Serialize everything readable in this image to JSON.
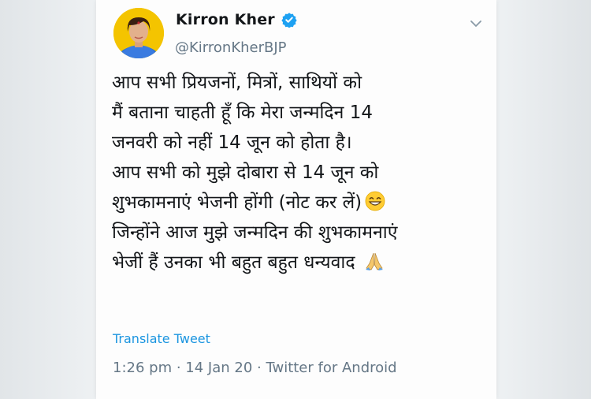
{
  "tweet": {
    "author_name": "Kirron Kher",
    "author_handle": "@KirronKherBJP",
    "lines": [
      "आप सभी प्रियजनों, मित्रों, साथियों को",
      "मैं बताना चाहती हूँ कि मेरा जन्मदिन 14",
      "जनवरी को नहीं 14 जून को होता है।",
      "आप सभी को मुझे दोबारा से 14 जून को",
      "शुभकामनाएं भेजनी होंगी (नोट कर लें)",
      "जिन्होंने आज मुझे जन्मदिन की शुभकामनाएं",
      "भेजीं हैं उनका भी बहुत बहुत धन्यवाद "
    ],
    "translate_label": "Translate Tweet",
    "time": "1:26 pm",
    "date": "14 Jan 20",
    "source": "Twitter for Android",
    "separator": " · "
  },
  "icons": {
    "verified": "verified-badge-icon",
    "caret": "chevron-down-icon",
    "grin": "grinning-emoji",
    "folded_hands": "folded-hands-emoji"
  },
  "colors": {
    "link": "#1b95e0",
    "secondary_text": "#657786",
    "verified_blue": "#1da1f2"
  }
}
